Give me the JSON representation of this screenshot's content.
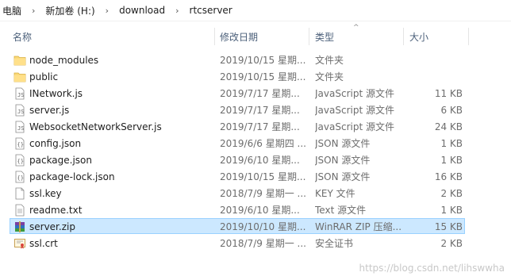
{
  "breadcrumb": [
    "电脑",
    "新加卷 (H:)",
    "download",
    "rtcserver"
  ],
  "columns": {
    "name": "名称",
    "date": "修改日期",
    "type": "类型",
    "size": "大小"
  },
  "files": [
    {
      "name": "node_modules",
      "date": "2019/10/15 星期...",
      "type": "文件夹",
      "size": "",
      "icon": "folder-icon"
    },
    {
      "name": "public",
      "date": "2019/10/15 星期...",
      "type": "文件夹",
      "size": "",
      "icon": "folder-icon"
    },
    {
      "name": "INetwork.js",
      "date": "2019/7/17 星期...",
      "type": "JavaScript 源文件",
      "size": "11 KB",
      "icon": "javascript-file-icon"
    },
    {
      "name": "server.js",
      "date": "2019/7/17 星期...",
      "type": "JavaScript 源文件",
      "size": "6 KB",
      "icon": "javascript-file-icon"
    },
    {
      "name": "WebsocketNetworkServer.js",
      "date": "2019/7/17 星期...",
      "type": "JavaScript 源文件",
      "size": "24 KB",
      "icon": "javascript-file-icon"
    },
    {
      "name": "config.json",
      "date": "2019/6/6 星期四 ...",
      "type": "JSON 源文件",
      "size": "1 KB",
      "icon": "json-file-icon"
    },
    {
      "name": "package.json",
      "date": "2019/6/10 星期...",
      "type": "JSON 源文件",
      "size": "1 KB",
      "icon": "json-file-icon"
    },
    {
      "name": "package-lock.json",
      "date": "2019/10/15 星期...",
      "type": "JSON 源文件",
      "size": "16 KB",
      "icon": "json-file-icon"
    },
    {
      "name": "ssl.key",
      "date": "2018/7/9 星期一 ...",
      "type": "KEY 文件",
      "size": "2 KB",
      "icon": "blank-file-icon"
    },
    {
      "name": "readme.txt",
      "date": "2019/6/10 星期...",
      "type": "Text 源文件",
      "size": "1 KB",
      "icon": "text-file-icon"
    },
    {
      "name": "server.zip",
      "date": "2019/10/10 星期...",
      "type": "WinRAR ZIP 压缩...",
      "size": "15 KB",
      "icon": "winrar-archive-icon",
      "selected": true
    },
    {
      "name": "ssl.crt",
      "date": "2018/7/9 星期一 ...",
      "type": "安全证书",
      "size": "2 KB",
      "icon": "certificate-icon"
    }
  ],
  "watermark": "https://blog.csdn.net/lihswwha",
  "colors": {
    "selected_bg": "#cce8ff",
    "selected_border": "#99d1ff",
    "folder": "#f8d775",
    "header_text": "#4c607a"
  }
}
